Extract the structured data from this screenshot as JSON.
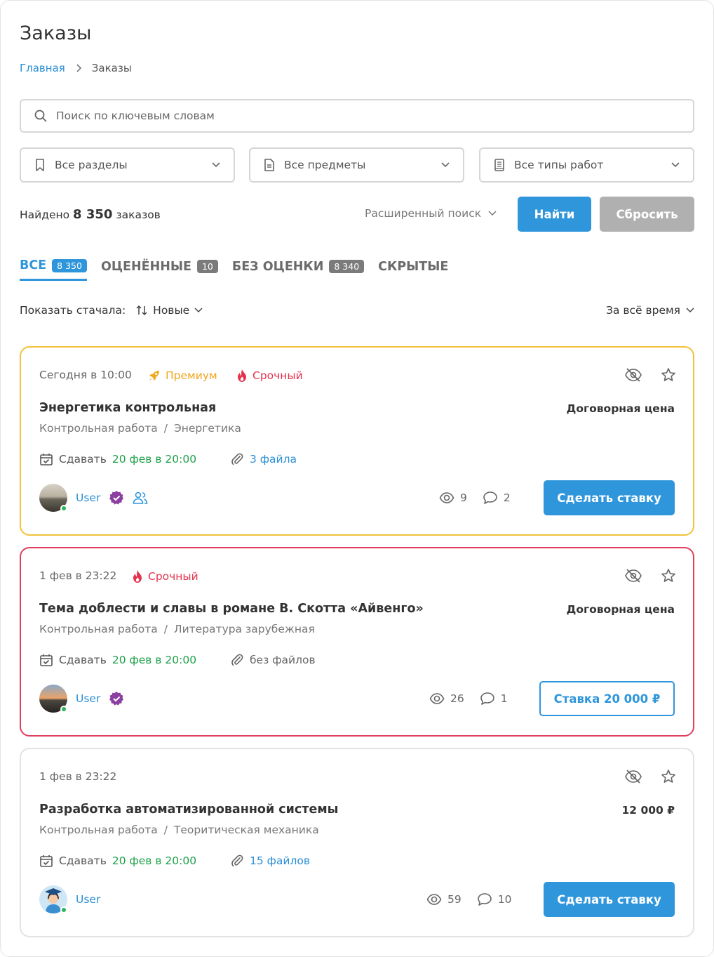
{
  "page": {
    "title": "Заказы"
  },
  "breadcrumb": {
    "home": "Главная",
    "current": "Заказы"
  },
  "search": {
    "placeholder": "Поиск по ключевым словам",
    "value": ""
  },
  "filters": [
    {
      "label": "Все разделы",
      "icon": "bookmark-icon"
    },
    {
      "label": "Все предметы",
      "icon": "document-icon"
    },
    {
      "label": "Все типы работ",
      "icon": "book-icon"
    }
  ],
  "results": {
    "prefix": "Найдено",
    "count": "8 350",
    "suffix": "заказов"
  },
  "advanced_search": "Расширенный поиск",
  "buttons": {
    "find": "Найти",
    "reset": "Сбросить"
  },
  "tabs": [
    {
      "label": "ВСЕ",
      "count": "8 350",
      "active": true
    },
    {
      "label": "ОЦЕНЁННЫЕ",
      "count": "10",
      "active": false
    },
    {
      "label": "БЕЗ ОЦЕНКИ",
      "count": "8 340",
      "active": false
    },
    {
      "label": "СКРЫТЫЕ",
      "count": "",
      "active": false
    }
  ],
  "sort": {
    "label": "Показать стачала:",
    "value": "Новые"
  },
  "period": "За всё время",
  "colors": {
    "accent": "#2f96db",
    "premium": "#f2c23a",
    "urgent": "#e0405e",
    "deadline": "#1fa14a",
    "verified": "#8b3fa0"
  },
  "orders": [
    {
      "date": "Сегодня в 10:00",
      "premium_label": "Премиум",
      "urgent_label": "Срочный",
      "title": "Энергетика контрольная",
      "price": "Договорная цена",
      "type": "Контрольная работа",
      "separator": "/",
      "subject": "Энергетика",
      "deadline_label": "Сдавать",
      "deadline": "20 фев в 20:00",
      "files": "3 файла",
      "user": "User",
      "views": "9",
      "comments": "2",
      "action": "Сделать ставку"
    },
    {
      "date": "1 фев в 23:22",
      "urgent_label": "Срочный",
      "title": "Тема доблести и славы в романе В. Скотта «Айвенго»",
      "price": "Договорная цена",
      "type": "Контрольная работа",
      "separator": "/",
      "subject": "Литература зарубежная",
      "deadline_label": "Сдавать",
      "deadline": "20 фев в 20:00",
      "files": "без файлов",
      "user": "User",
      "views": "26",
      "comments": "1",
      "action": "Ставка 20 000 ₽"
    },
    {
      "date": "1 фев в 23:22",
      "title": "Разработка автоматизированной системы",
      "price": "12 000 ₽",
      "type": "Контрольная работа",
      "separator": "/",
      "subject": "Теоритическая механика",
      "deadline_label": "Сдавать",
      "deadline": "20 фев в 20:00",
      "files": "15 файлов",
      "user": "User",
      "views": "59",
      "comments": "10",
      "action": "Сделать ставку"
    }
  ]
}
